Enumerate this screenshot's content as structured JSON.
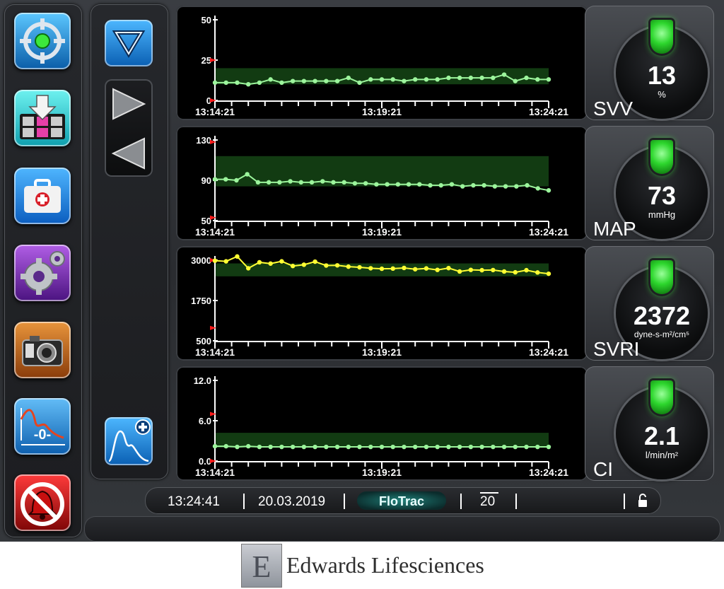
{
  "status_bar": {
    "time": "13:24:41",
    "date": "20.03.2019",
    "mode": "FloTrac",
    "interval": "20"
  },
  "icons": {
    "left_buttons": [
      "target-icon",
      "monitoring-screen-icon",
      "clinical-actions-icon",
      "settings-gear-icon",
      "snapshot-camera-icon",
      "zero-waveform-icon",
      "alarm-silence-icon"
    ],
    "nav": [
      "scroll-down-icon",
      "play-forward-icon",
      "play-back-icon",
      "add-waveform-icon"
    ],
    "status": [
      "lock-icon"
    ]
  },
  "colors": {
    "target_band": "#123b12",
    "series_green": "#9cf59c",
    "series_yellow": "#ffff33",
    "alarm_marker": "#ff1a1a",
    "indicator_green": "#2dd62d"
  },
  "trends": [
    {
      "parameter": "SVV",
      "ticks": [
        "50",
        "25",
        "0"
      ],
      "times": [
        "13:14:21",
        "13:19:21",
        "13:24:21"
      ],
      "chart_data": {
        "type": "line",
        "ylim": [
          0,
          50
        ],
        "yticks": [
          50,
          25,
          0
        ],
        "target_range": [
          10,
          20
        ],
        "alarm_limits": [
          0,
          25
        ],
        "series_color": "green",
        "values": [
          11,
          11,
          11,
          10,
          11,
          13,
          11,
          12,
          12,
          12,
          12,
          12,
          14,
          11,
          13,
          13,
          13,
          12,
          13,
          13,
          13,
          14,
          14,
          14,
          14,
          14,
          16,
          12,
          14,
          13,
          13
        ]
      }
    },
    {
      "parameter": "MAP",
      "ticks": [
        "130",
        "90",
        "50"
      ],
      "times": [
        "13:14:21",
        "13:19:21",
        "13:24:21"
      ],
      "chart_data": {
        "type": "line",
        "ylim": [
          50,
          130
        ],
        "yticks": [
          130,
          90,
          50
        ],
        "target_range": [
          84,
          114
        ],
        "alarm_limits": [
          53,
          128
        ],
        "series_color": "green",
        "values": [
          91,
          91,
          90,
          96,
          88,
          88,
          88,
          89,
          88,
          88,
          89,
          88,
          88,
          87,
          87,
          86,
          86,
          86,
          86,
          86,
          85,
          85,
          86,
          84,
          85,
          85,
          84,
          84,
          84,
          85,
          82,
          80
        ]
      }
    },
    {
      "parameter": "SVRI",
      "ticks": [
        "3000",
        "1750",
        "500"
      ],
      "times": [
        "13:14:21",
        "13:19:21",
        "13:24:21"
      ],
      "chart_data": {
        "type": "line",
        "ylim": [
          500,
          3000
        ],
        "yticks": [
          3000,
          1750,
          500
        ],
        "target_range": [
          2500,
          2900
        ],
        "alarm_limits": [
          900,
          3000
        ],
        "series_color": "yellow",
        "values": [
          2985,
          2965,
          3115,
          2750,
          2935,
          2895,
          2965,
          2820,
          2860,
          2955,
          2835,
          2840,
          2800,
          2780,
          2750,
          2735,
          2740,
          2760,
          2720,
          2745,
          2700,
          2755,
          2650,
          2700,
          2690,
          2695,
          2650,
          2625,
          2690,
          2620,
          2580
        ]
      }
    },
    {
      "parameter": "CI",
      "ticks": [
        "12.0",
        "6.0",
        "0.0"
      ],
      "times": [
        "13:14:21",
        "13:19:21",
        "13:24:21"
      ],
      "chart_data": {
        "type": "line",
        "ylim": [
          0,
          12
        ],
        "yticks": [
          12.0,
          6.0,
          0.0
        ],
        "target_range": [
          2.0,
          4.2
        ],
        "alarm_limits": [
          0,
          7.0
        ],
        "series_color": "green",
        "values": [
          2.2,
          2.2,
          2.1,
          2.2,
          2.1,
          2.1,
          2.1,
          2.1,
          2.1,
          2.1,
          2.1,
          2.1,
          2.1,
          2.1,
          2.1,
          2.1,
          2.1,
          2.1,
          2.1,
          2.1,
          2.1,
          2.1,
          2.1,
          2.1,
          2.1,
          2.1,
          2.1,
          2.1,
          2.1,
          2.1,
          2.1
        ]
      }
    }
  ],
  "tiles": [
    {
      "name": "SVV",
      "value": "13",
      "unit": "%"
    },
    {
      "name": "MAP",
      "value": "73",
      "unit": "mmHg"
    },
    {
      "name": "SVRI",
      "value": "2372",
      "unit": "dyne-s-m²/cm⁵"
    },
    {
      "name": "CI",
      "value": "2.1",
      "unit": "l/min/m²"
    }
  ],
  "footer": {
    "brand": "Edwards Lifesciences",
    "logo_letter": "E"
  }
}
